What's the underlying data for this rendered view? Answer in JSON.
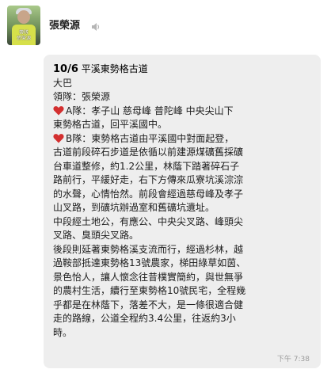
{
  "sender": {
    "name": "張榮源",
    "avatar_caption": "帶隊\n張榮源"
  },
  "message": {
    "date": "10/6",
    "route_name": "平溪東勢格古道",
    "lines": [
      "大巴",
      "領隊：張榮源",
      "A隊：孝子山 慈母峰 普陀峰 中央尖山下",
      "東勢格古道，回平溪國中。",
      "B隊：東勢格古道由平溪國中對面起登，",
      "古道前段碎石步道是依循以前建源煤礦舊採礦",
      "台車道整修，約1.2公里，林蔭下踏著碎石子",
      "路前行，平緩好走，右下方傳來瓜寮坑溪淙淙",
      "的水聲，心情怡然。前段會經過慈母峰及孝子",
      "山叉路，到礦坑辦過室和舊礦坑遺址。",
      "中段經土地公，有應公、中央尖叉路、峰頭尖",
      "叉路、臭頭尖叉路。",
      "後段則延著東勢格溪支流而行，經過杉林，越",
      "過鞍部抵達東勢格13號農家，梯田綠草如茵、",
      "景色怡人，讓人懷念往昔樸實簡約，與世無爭",
      "的農村生活，續行至東勢格10號民宅，全程幾",
      "乎都是在林蔭下，落差不大，是一條很適合健",
      "走的路線，公道全程約3.4公里，往返約3小",
      "時。"
    ],
    "time": "下午 7:38"
  },
  "colors": {
    "bubble": "#eeeeee",
    "heart": "#d32f2f",
    "time": "#9a9a9a"
  },
  "icons": {
    "speaker": "speaker-icon",
    "heart": "heart-icon"
  }
}
